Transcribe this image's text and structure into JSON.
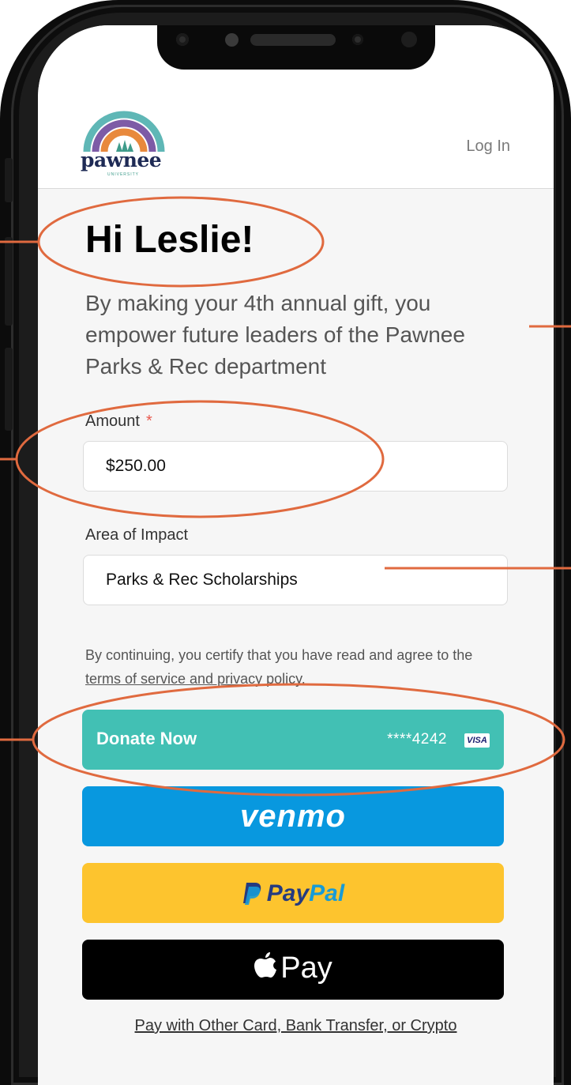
{
  "header": {
    "logo_text": "pawnee",
    "logo_subtext": "UNIVERSITY",
    "login_label": "Log In"
  },
  "greeting": "Hi Leslie!",
  "subtitle": "By making your 4th annual gift, you empower future leaders of the Pawnee Parks & Rec department",
  "amount": {
    "label": "Amount",
    "required_mark": "*",
    "value": "$250.00"
  },
  "impact": {
    "label": "Area of Impact",
    "value": "Parks & Rec Scholarships"
  },
  "terms": {
    "prefix": "By continuing, you certify that you have read and agree to the ",
    "link": "terms of service and privacy policy",
    "suffix": "."
  },
  "donate_button": {
    "label": "Donate Now",
    "card_number": "****4242",
    "card_brand": "VISA"
  },
  "venmo_button": {
    "label": "venmo"
  },
  "paypal_button": {
    "label_part1": "Pay",
    "label_part2": "Pal"
  },
  "applepay_button": {
    "label": "Pay"
  },
  "other_payment_link": "Pay with Other Card, Bank Transfer, or Crypto",
  "colors": {
    "accent_teal": "#42c0b4",
    "venmo_blue": "#0898df",
    "paypal_yellow": "#fdc42e",
    "annotation_orange": "#e06a3f",
    "logo_teal": "#5fb7b6",
    "logo_purple": "#7d5ba6",
    "logo_orange": "#e8893d"
  }
}
